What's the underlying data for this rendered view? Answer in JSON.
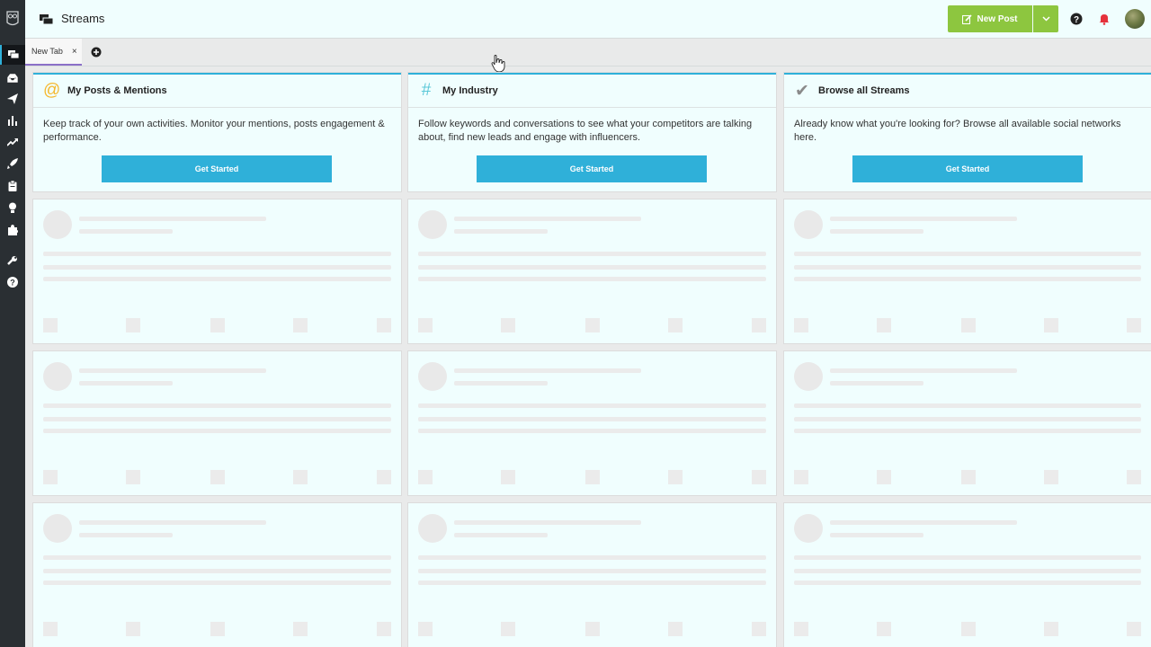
{
  "app": {
    "title": "Streams",
    "accent": "#2fb0d9",
    "green": "#8dc63f",
    "sidebar_bg": "#2a2f33"
  },
  "sidebar": {
    "logo_icon": "owl-logo-icon",
    "items": [
      {
        "icon": "streams-icon",
        "active": true
      },
      {
        "icon": "inbox-icon"
      },
      {
        "icon": "publisher-icon"
      },
      {
        "icon": "analytics-icon"
      },
      {
        "icon": "trending-icon"
      },
      {
        "icon": "rocket-icon"
      },
      {
        "icon": "clipboard-icon"
      },
      {
        "icon": "lightbulb-icon"
      },
      {
        "icon": "puzzle-icon"
      },
      {
        "icon": "wrench-icon"
      },
      {
        "icon": "help-icon"
      }
    ]
  },
  "topbar": {
    "title": "Streams",
    "new_post_label": "New Post"
  },
  "tabs": {
    "items": [
      {
        "label": "New Tab",
        "close": "×"
      }
    ]
  },
  "cards": [
    {
      "icon": "at-icon",
      "glyph": "@",
      "glyph_color": "#f5b82e",
      "title": "My Posts & Mentions",
      "description": "Keep track of your own activities. Monitor your mentions, posts engagement & performance.",
      "button": "Get Started"
    },
    {
      "icon": "hashtag-icon",
      "glyph": "#",
      "glyph_color": "#5bc8d8",
      "title": "My Industry",
      "description": "Follow keywords and conversations to see what your competitors are talking about, find new leads and engage with influencers.",
      "button": "Get Started"
    },
    {
      "icon": "checkmark-icon",
      "glyph": "✔",
      "glyph_color": "#8a8a8a",
      "title": "Browse all Streams",
      "description": "Already know what you're looking for? Browse all available social networks here.",
      "button": "Get Started"
    }
  ]
}
